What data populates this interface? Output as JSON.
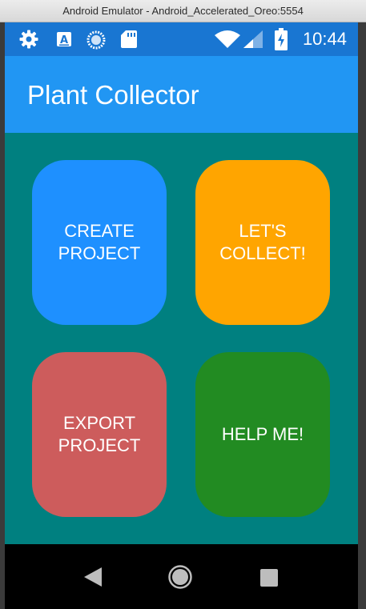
{
  "window": {
    "title": "Android Emulator - Android_Accelerated_Oreo:5554"
  },
  "status_bar": {
    "time": "10:44",
    "icons_left": [
      "gear-icon",
      "keyboard-a-icon",
      "sync-icon",
      "sd-card-icon"
    ],
    "icons_right": [
      "wifi-icon",
      "signal-icon",
      "battery-charging-icon"
    ]
  },
  "app_bar": {
    "title": "Plant Collector"
  },
  "buttons": {
    "create_project": {
      "label": "CREATE\nPROJECT",
      "color": "#1e90ff"
    },
    "lets_collect": {
      "label": "LET'S\nCOLLECT!",
      "color": "#ffa500"
    },
    "export_project": {
      "label": "EXPORT\nPROJECT",
      "color": "#cd5c5c"
    },
    "help_me": {
      "label": "HELP ME!",
      "color": "#228b22"
    }
  },
  "colors": {
    "status_bar": "#1976d2",
    "app_bar": "#2196f3",
    "content_bg": "#008080"
  },
  "nav_bar": {
    "icons": [
      "back-icon",
      "home-icon",
      "recents-icon"
    ]
  }
}
